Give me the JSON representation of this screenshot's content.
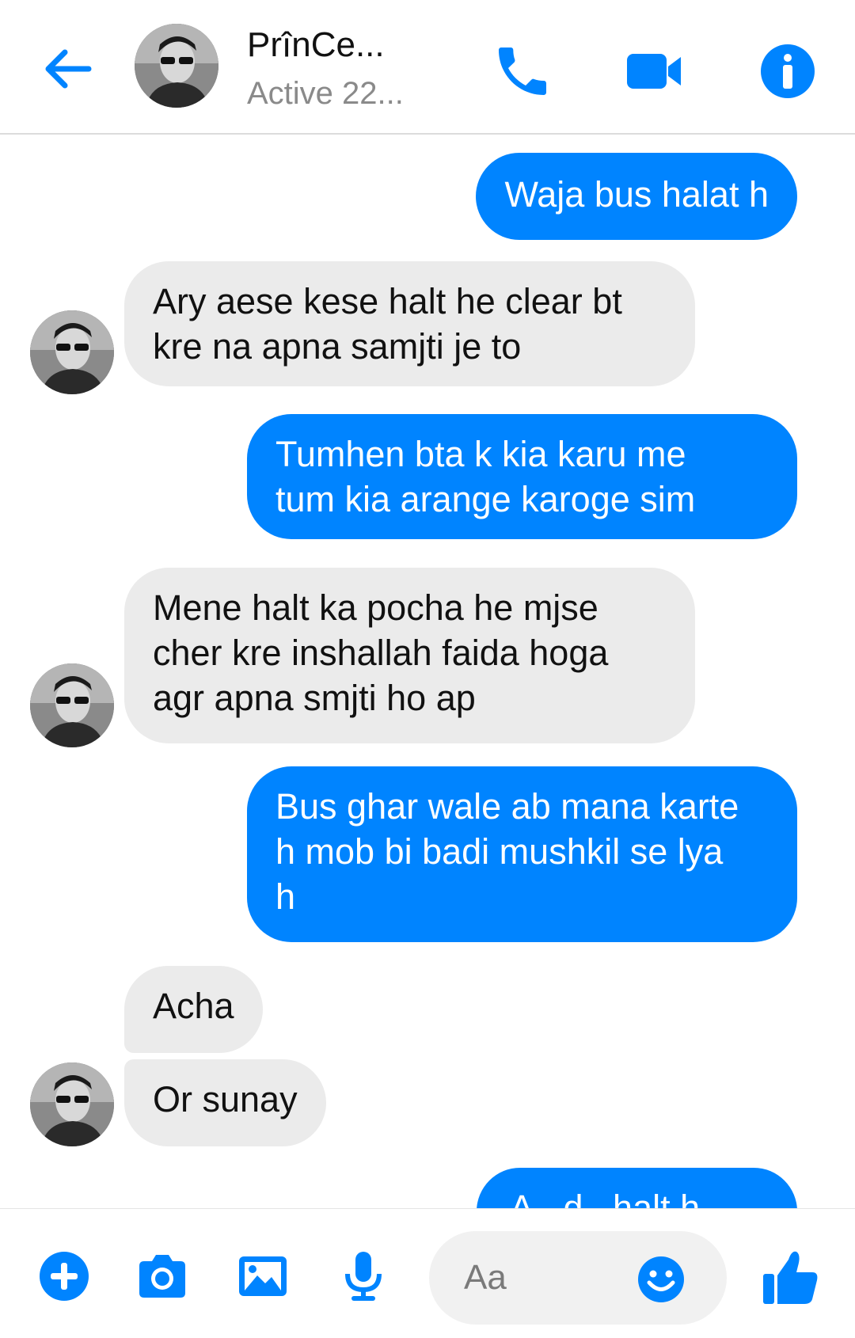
{
  "header": {
    "contact_name": "PrînCe...",
    "contact_status": "Active 22...",
    "back_icon": "arrow-left-icon",
    "call_icon": "phone-icon",
    "video_icon": "video-camera-icon",
    "info_icon": "info-icon"
  },
  "messages": [
    {
      "direction": "outgoing",
      "text": "Waja bus halat h"
    },
    {
      "direction": "incoming",
      "text": "Ary aese kese halt he clear bt\nkre na apna samjti je to"
    },
    {
      "direction": "outgoing",
      "text": "Tumhen bta k kia karu me\ntum kia arange karoge sim"
    },
    {
      "direction": "incoming",
      "text": "Mene halt ka pocha he mjse\ncher kre inshallah faida hoga\nagr apna smjti ho  ap"
    },
    {
      "direction": "outgoing",
      "text": "Bus ghar wale ab mana karte\nh mob bi badi mushkil se lya\nh"
    },
    {
      "direction": "incoming",
      "text": "Acha"
    },
    {
      "direction": "incoming",
      "text": "Or sunay"
    },
    {
      "direction": "outgoing",
      "text": "A...d...halt h...",
      "partially_visible": true
    }
  ],
  "composer": {
    "placeholder": "Aa",
    "icons": [
      "plus-icon",
      "camera-icon",
      "image-icon",
      "microphone-icon",
      "emoji-icon",
      "thumbs-up-icon"
    ]
  },
  "colors": {
    "accent": "#0084ff",
    "incoming_bubble": "#ebebeb",
    "outgoing_text": "#ffffff"
  }
}
